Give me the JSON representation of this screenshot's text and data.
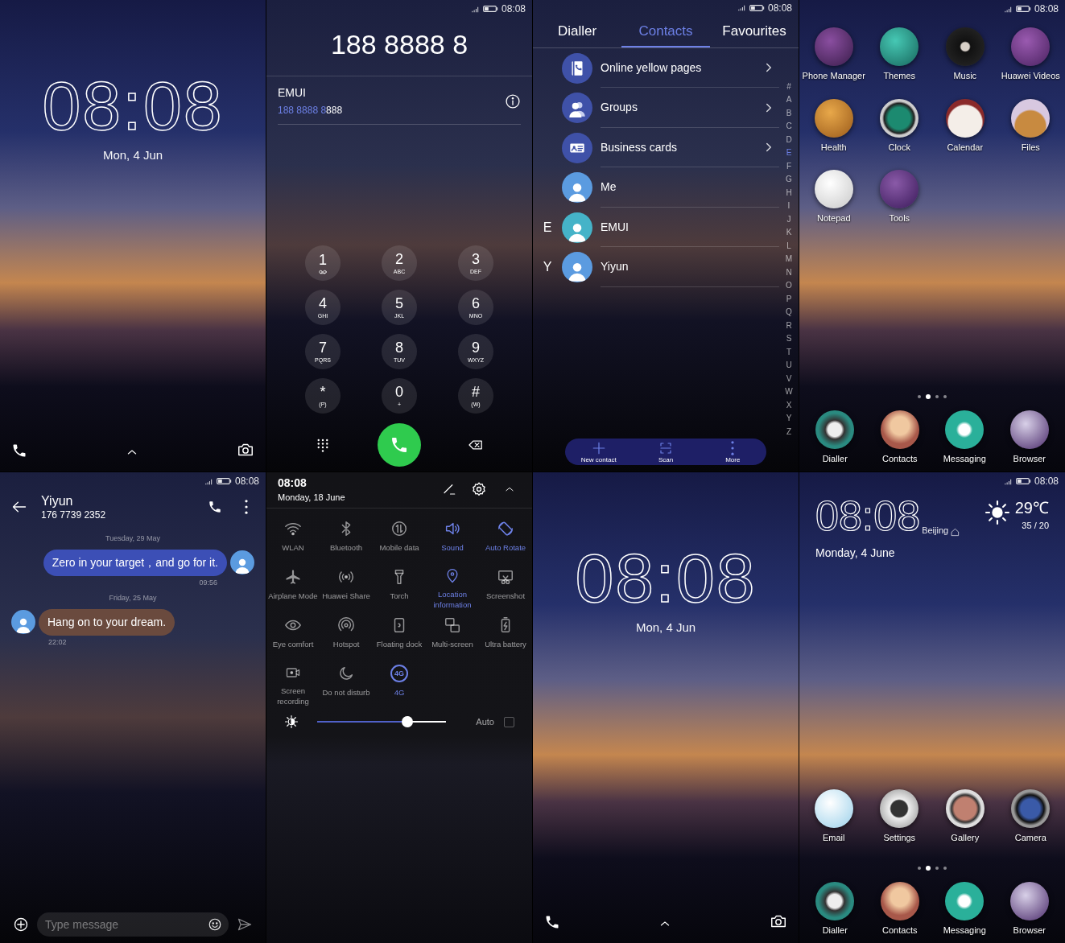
{
  "lock_screen_top": {
    "time": "08:08",
    "date": "Mon, 4 Jun"
  },
  "dialler": {
    "status_time": "08:08",
    "number": "188 8888 8",
    "match": {
      "name": "EMUI",
      "number_typed": "188 8888 8",
      "number_rest": "888"
    },
    "keys": [
      {
        "digit": "1",
        "kind": "voicemail"
      },
      {
        "digit": "2",
        "kind": "letters",
        "sub": "ABC"
      },
      {
        "digit": "3",
        "kind": "letters",
        "sub": "DEF"
      },
      {
        "digit": "4",
        "kind": "letters",
        "sub": "GHI"
      },
      {
        "digit": "5",
        "kind": "letters",
        "sub": "JKL"
      },
      {
        "digit": "6",
        "kind": "letters",
        "sub": "MNO"
      },
      {
        "digit": "7",
        "kind": "letters",
        "sub": "PQRS"
      },
      {
        "digit": "8",
        "kind": "letters",
        "sub": "TUV"
      },
      {
        "digit": "9",
        "kind": "letters",
        "sub": "WXYZ"
      },
      {
        "digit": "*",
        "kind": "letters",
        "sub": "(P)"
      },
      {
        "digit": "0",
        "kind": "letters",
        "sub": "+"
      },
      {
        "digit": "#",
        "kind": "letters",
        "sub": "(W)"
      }
    ]
  },
  "contacts": {
    "status_time": "08:08",
    "tabs": [
      {
        "label": "Dialler",
        "selected": false
      },
      {
        "label": "Contacts",
        "selected": true
      },
      {
        "label": "Favourites",
        "selected": false
      }
    ],
    "items": [
      {
        "kind": "yellow_pages",
        "label": "Online yellow pages"
      },
      {
        "kind": "groups",
        "label": "Groups"
      },
      {
        "kind": "business_cards",
        "label": "Business cards"
      },
      {
        "kind": "contact",
        "label": "Me",
        "color": "#5b9be0"
      },
      {
        "kind": "contact",
        "label": "EMUI",
        "section": "E",
        "color": "#45b3c8"
      },
      {
        "kind": "contact",
        "label": "Yiyun",
        "section": "Y",
        "color": "#5b9be0"
      }
    ],
    "index": [
      {
        "letter": "#",
        "selected": false
      },
      {
        "letter": "A",
        "selected": false
      },
      {
        "letter": "B",
        "selected": false
      },
      {
        "letter": "C",
        "selected": false
      },
      {
        "letter": "D",
        "selected": false
      },
      {
        "letter": "E",
        "selected": true
      },
      {
        "letter": "F",
        "selected": false
      },
      {
        "letter": "G",
        "selected": false
      },
      {
        "letter": "H",
        "selected": false
      },
      {
        "letter": "I",
        "selected": false
      },
      {
        "letter": "J",
        "selected": false
      },
      {
        "letter": "K",
        "selected": false
      },
      {
        "letter": "L",
        "selected": false
      },
      {
        "letter": "M",
        "selected": false
      },
      {
        "letter": "N",
        "selected": false
      },
      {
        "letter": "O",
        "selected": false
      },
      {
        "letter": "P",
        "selected": false
      },
      {
        "letter": "Q",
        "selected": false
      },
      {
        "letter": "R",
        "selected": false
      },
      {
        "letter": "S",
        "selected": false
      },
      {
        "letter": "T",
        "selected": false
      },
      {
        "letter": "U",
        "selected": false
      },
      {
        "letter": "V",
        "selected": false
      },
      {
        "letter": "W",
        "selected": false
      },
      {
        "letter": "X",
        "selected": false
      },
      {
        "letter": "Y",
        "selected": false
      },
      {
        "letter": "Z",
        "selected": false
      }
    ],
    "actions": [
      {
        "kind": "add",
        "label": "New contact"
      },
      {
        "kind": "scan",
        "label": "Scan"
      },
      {
        "kind": "more",
        "label": "More"
      }
    ]
  },
  "home_apps": {
    "status_time": "08:08",
    "apps": [
      "Phone Manager",
      "Themes",
      "Music",
      "Huawei Videos",
      "Health",
      "Clock",
      "Calendar",
      "Files",
      "Notepad",
      "Tools"
    ],
    "page_dots": [
      {
        "selected": false
      },
      {
        "selected": true
      },
      {
        "selected": false
      },
      {
        "selected": false
      }
    ],
    "dock": [
      "Dialler",
      "Contacts",
      "Messaging",
      "Browser"
    ]
  },
  "messages": {
    "status_time": "08:08",
    "name": "Yiyun",
    "number": "176 7739 2352",
    "thread": [
      {
        "date": "Tuesday, 29 May",
        "kind": "sent",
        "text": "Zero in your target，and go for it.",
        "time": "09:56"
      },
      {
        "date": "Friday, 25 May",
        "kind": "received",
        "text": "Hang on to your dream.",
        "time": "22:02"
      }
    ],
    "input": {
      "placeholder": "Type message"
    }
  },
  "quick_settings": {
    "time": "08:08",
    "date": "Monday, 18 June",
    "tiles": [
      {
        "kind": "wlan",
        "label": "WLAN",
        "on": false
      },
      {
        "kind": "bluetooth",
        "label": "Bluetooth",
        "on": false
      },
      {
        "kind": "mobile_data",
        "label": "Mobile data",
        "on": false
      },
      {
        "kind": "sound",
        "label": "Sound",
        "on": true
      },
      {
        "kind": "rotate",
        "label": "Auto Rotate",
        "on": true
      },
      {
        "kind": "airplane",
        "label": "Airplane Mode",
        "on": false
      },
      {
        "kind": "share",
        "label": "Huawei Share",
        "on": false
      },
      {
        "kind": "torch",
        "label": "Torch",
        "on": false
      },
      {
        "kind": "location",
        "label": "Location information",
        "on": true
      },
      {
        "kind": "screenshot",
        "label": "Screenshot",
        "on": false
      },
      {
        "kind": "eye",
        "label": "Eye comfort",
        "on": false
      },
      {
        "kind": "hotspot",
        "label": "Hotspot",
        "on": false
      },
      {
        "kind": "dock",
        "label": "Floating dock",
        "on": false
      },
      {
        "kind": "multiscreen",
        "label": "Multi-screen",
        "on": false
      },
      {
        "kind": "battery",
        "label": "Ultra battery",
        "on": false
      },
      {
        "kind": "record",
        "label": "Screen recording",
        "on": false
      },
      {
        "kind": "dnd",
        "label": "Do not disturb",
        "on": false
      },
      {
        "kind": "badge",
        "badge": "4G",
        "label": "4G",
        "on": true
      }
    ],
    "brightness": {
      "level": 0.7
    },
    "auto": {
      "label": "Auto",
      "checked": false
    }
  },
  "lock_screen_bottom": {
    "time": "08:08",
    "date": "Mon, 4 Jun"
  },
  "home_widgets": {
    "status_time": "08:08",
    "clock": "08:08",
    "city": "Beijing",
    "date": "Monday, 4 June",
    "temperature": "29℃",
    "range": "35 / 20",
    "apps": [
      "Email",
      "Settings",
      "Gallery",
      "Camera"
    ],
    "page_dots": [
      {
        "selected": false
      },
      {
        "selected": true
      },
      {
        "selected": false
      },
      {
        "selected": false
      }
    ],
    "dock": [
      "Dialler",
      "Contacts",
      "Messaging",
      "Browser"
    ]
  }
}
